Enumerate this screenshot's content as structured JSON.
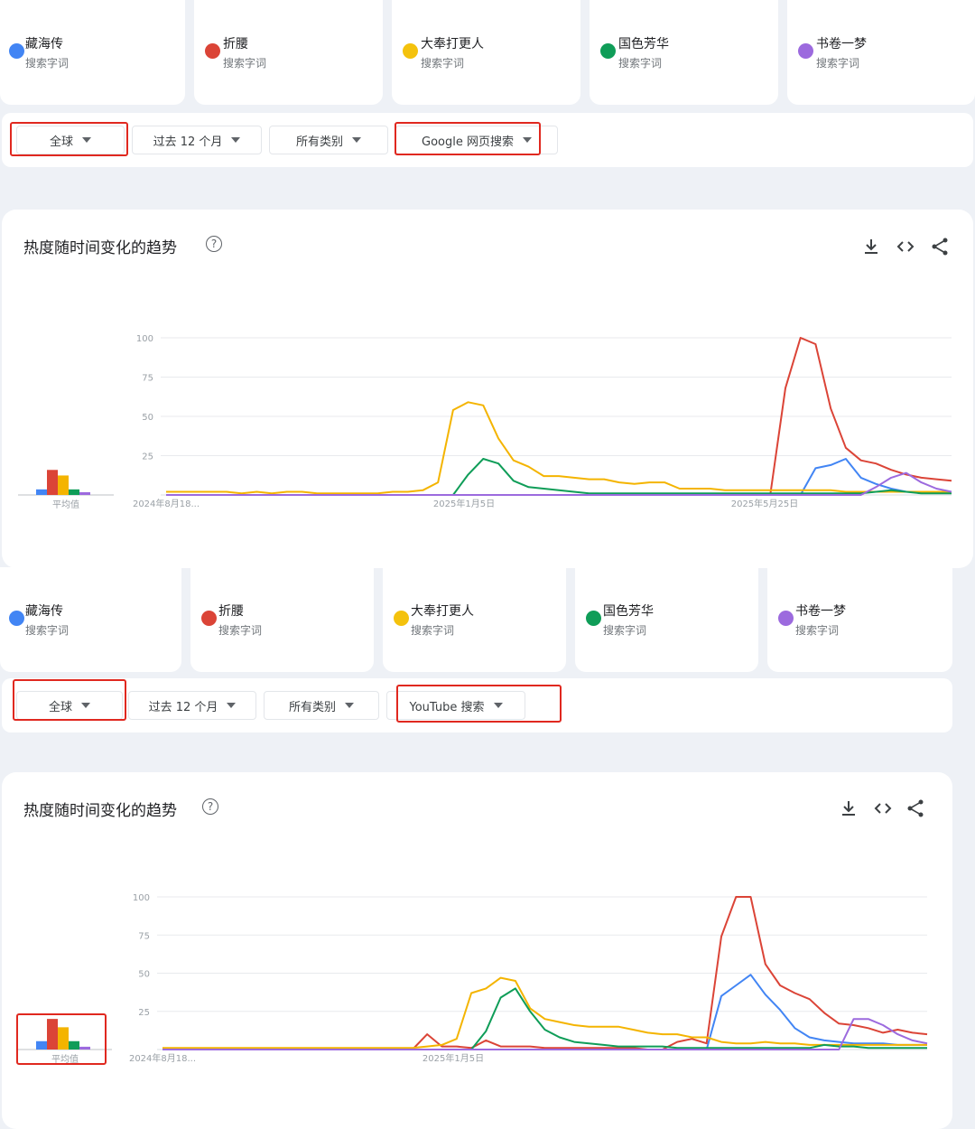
{
  "terms": [
    {
      "name": "藏海传",
      "sub": "搜索字词",
      "color": "#4285f4"
    },
    {
      "name": "折腰",
      "sub": "搜索字词",
      "color": "#db4437"
    },
    {
      "name": "大奉打更人",
      "sub": "搜索字词",
      "color": "#f4b400"
    },
    {
      "name": "国色芳华",
      "sub": "搜索字词",
      "color": "#0f9d58"
    },
    {
      "name": "书卷一梦",
      "sub": "搜索字词",
      "color": "#9c6ade"
    }
  ],
  "panel1": {
    "filters": {
      "region": "全球",
      "time": "过去 12 个月",
      "category": "所有类别",
      "search_type": "Google 网页搜索"
    },
    "chart_title": "热度随时间变化的趋势",
    "help": "?",
    "avg_label": "平均值"
  },
  "panel2": {
    "filters": {
      "region": "全球",
      "time": "过去 12 个月",
      "category": "所有类别",
      "search_type": "YouTube 搜索"
    },
    "chart_title": "热度随时间变化的趋势",
    "help": "?",
    "avg_label": "平均值"
  },
  "icons": [
    "download-icon",
    "embed-code-icon",
    "share-icon",
    "help-icon"
  ],
  "chart_data": [
    {
      "type": "line",
      "x_tick_labels": [
        "2024年8月18...",
        "2025年1月5日",
        "2025年5月25日"
      ],
      "y_ticks": [
        100,
        75,
        50,
        25
      ],
      "ylim": [
        0,
        100
      ],
      "grid": true,
      "n_points": 53,
      "averages": [
        2,
        9,
        7,
        2,
        1
      ],
      "series": [
        {
          "name": "藏海传",
          "color": "#4285f4",
          "values": [
            0,
            0,
            0,
            0,
            0,
            0,
            0,
            0,
            0,
            0,
            0,
            0,
            0,
            0,
            0,
            0,
            0,
            0,
            0,
            0,
            0,
            0,
            0,
            0,
            0,
            0,
            0,
            0,
            0,
            0,
            0,
            0,
            0,
            0,
            0,
            0,
            0,
            0,
            0,
            0,
            0,
            0,
            0,
            17,
            19,
            23,
            11,
            7,
            4,
            2,
            2,
            2,
            2
          ]
        },
        {
          "name": "折腰",
          "color": "#db4437",
          "values": [
            0,
            0,
            0,
            0,
            0,
            0,
            0,
            0,
            0,
            0,
            0,
            0,
            0,
            0,
            0,
            0,
            0,
            0,
            0,
            0,
            0,
            0,
            0,
            0,
            0,
            0,
            0,
            0,
            0,
            0,
            0,
            0,
            0,
            0,
            0,
            0,
            0,
            0,
            0,
            0,
            0,
            68,
            100,
            96,
            55,
            30,
            22,
            20,
            16,
            13,
            11,
            10,
            9,
            8,
            7,
            8
          ]
        },
        {
          "name": "大奉打更人",
          "color": "#f4b400",
          "values": [
            2,
            2,
            2,
            2,
            2,
            1,
            2,
            1,
            2,
            2,
            1,
            1,
            1,
            1,
            1,
            2,
            2,
            3,
            8,
            54,
            59,
            57,
            36,
            22,
            18,
            12,
            12,
            11,
            10,
            10,
            8,
            7,
            8,
            8,
            4,
            4,
            4,
            3,
            3,
            3,
            3,
            3,
            3,
            3,
            3,
            2,
            2,
            2,
            2,
            2,
            2,
            2,
            2
          ]
        },
        {
          "name": "国色芳华",
          "color": "#0f9d58",
          "values": [
            0,
            0,
            0,
            0,
            0,
            0,
            0,
            0,
            0,
            0,
            0,
            0,
            0,
            0,
            0,
            0,
            0,
            0,
            0,
            0,
            13,
            23,
            20,
            9,
            5,
            4,
            3,
            2,
            1,
            1,
            1,
            1,
            1,
            1,
            1,
            1,
            1,
            1,
            1,
            1,
            1,
            1,
            1,
            1,
            1,
            1,
            1,
            2,
            3,
            2,
            1,
            1,
            1
          ]
        },
        {
          "name": "书卷一梦",
          "color": "#9c6ade",
          "values": [
            0,
            0,
            0,
            0,
            0,
            0,
            0,
            0,
            0,
            0,
            0,
            0,
            0,
            0,
            0,
            0,
            0,
            0,
            0,
            0,
            0,
            0,
            0,
            0,
            0,
            0,
            0,
            0,
            0,
            0,
            0,
            0,
            0,
            0,
            0,
            0,
            0,
            0,
            0,
            0,
            0,
            0,
            0,
            0,
            0,
            0,
            0,
            5,
            11,
            14,
            8,
            4,
            2,
            1,
            1
          ]
        }
      ]
    },
    {
      "type": "line",
      "x_tick_labels": [
        "2024年8月18...",
        "2025年1月5日"
      ],
      "y_ticks": [
        100,
        75,
        50,
        25
      ],
      "ylim": [
        0,
        100
      ],
      "grid": true,
      "n_points": 53,
      "averages": [
        3,
        11,
        8,
        3,
        1
      ],
      "series": [
        {
          "name": "藏海传",
          "color": "#4285f4",
          "values": [
            0,
            0,
            0,
            0,
            0,
            0,
            0,
            0,
            0,
            0,
            0,
            0,
            0,
            0,
            0,
            0,
            0,
            0,
            0,
            0,
            0,
            0,
            0,
            0,
            0,
            0,
            0,
            0,
            0,
            0,
            0,
            0,
            0,
            0,
            0,
            0,
            0,
            0,
            35,
            42,
            49,
            36,
            26,
            14,
            8,
            6,
            5,
            4,
            4,
            4,
            3,
            3,
            3
          ]
        },
        {
          "name": "折腰",
          "color": "#db4437",
          "values": [
            0,
            0,
            0,
            0,
            0,
            0,
            0,
            0,
            0,
            0,
            0,
            0,
            0,
            0,
            0,
            0,
            0,
            0,
            10,
            2,
            2,
            1,
            6,
            2,
            2,
            2,
            1,
            1,
            1,
            1,
            1,
            1,
            1,
            0,
            0,
            5,
            7,
            4,
            74,
            100,
            100,
            56,
            42,
            37,
            33,
            24,
            17,
            16,
            14,
            11,
            13,
            11,
            10
          ]
        },
        {
          "name": "大奉打更人",
          "color": "#f4b400",
          "values": [
            1,
            1,
            1,
            1,
            1,
            1,
            1,
            1,
            1,
            1,
            1,
            1,
            1,
            1,
            1,
            1,
            1,
            1,
            2,
            3,
            7,
            37,
            40,
            47,
            45,
            27,
            20,
            18,
            16,
            15,
            15,
            15,
            13,
            11,
            10,
            10,
            8,
            8,
            5,
            4,
            4,
            5,
            4,
            4,
            3,
            3,
            3,
            3,
            3,
            3,
            3,
            3,
            3
          ]
        },
        {
          "name": "国色芳华",
          "color": "#0f9d58",
          "values": [
            0,
            0,
            0,
            0,
            0,
            0,
            0,
            0,
            0,
            0,
            0,
            0,
            0,
            0,
            0,
            0,
            0,
            0,
            0,
            0,
            0,
            0,
            12,
            34,
            40,
            25,
            13,
            8,
            5,
            4,
            3,
            2,
            2,
            2,
            2,
            1,
            1,
            1,
            1,
            1,
            1,
            1,
            1,
            1,
            1,
            3,
            2,
            2,
            1,
            1,
            1,
            1,
            1
          ]
        },
        {
          "name": "书卷一梦",
          "color": "#9c6ade",
          "values": [
            0,
            0,
            0,
            0,
            0,
            0,
            0,
            0,
            0,
            0,
            0,
            0,
            0,
            0,
            0,
            0,
            0,
            0,
            0,
            0,
            0,
            0,
            0,
            0,
            0,
            0,
            0,
            0,
            0,
            0,
            0,
            0,
            0,
            0,
            0,
            0,
            0,
            0,
            0,
            0,
            0,
            0,
            0,
            0,
            0,
            0,
            0,
            20,
            20,
            16,
            10,
            6,
            4,
            3
          ]
        }
      ]
    }
  ]
}
